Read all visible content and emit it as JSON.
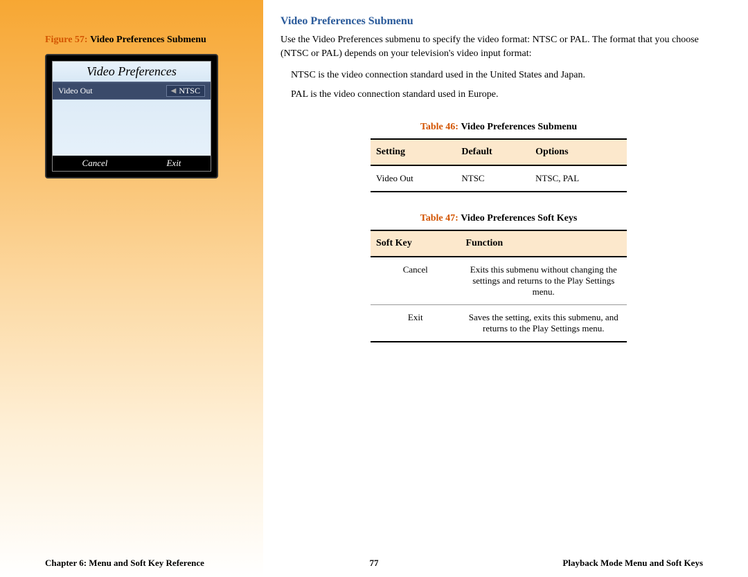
{
  "figure": {
    "label": "Figure 57:",
    "text": "Video Preferences Submenu"
  },
  "screenshot": {
    "title": "Video Preferences",
    "row_label": "Video Out",
    "row_value": "NTSC",
    "softkey_left": "Cancel",
    "softkey_right": "Exit"
  },
  "heading": "Video Preferences Submenu",
  "para1": "Use the Video Preferences submenu to specify the video format: NTSC or PAL. The format that you choose (NTSC or PAL) depends on your television's video input format:",
  "para2": "NTSC is the video connection standard used in the United States and Japan.",
  "para3": "PAL is the video connection standard used in Europe.",
  "table46": {
    "label": "Table 46:",
    "text": "Video Preferences Submenu",
    "headers": [
      "Setting",
      "Default",
      "Options"
    ],
    "rows": [
      [
        "Video Out",
        "NTSC",
        "NTSC, PAL"
      ]
    ]
  },
  "table47": {
    "label": "Table 47:",
    "text": "Video Preferences Soft Keys",
    "headers": [
      "Soft Key",
      "Function"
    ],
    "rows": [
      [
        "Cancel",
        "Exits this submenu without changing the settings and returns to the Play Settings menu."
      ],
      [
        "Exit",
        "Saves the setting, exits this submenu, and returns to the Play Settings menu."
      ]
    ]
  },
  "footer": {
    "left": "Chapter 6: Menu and Soft Key Reference",
    "center": "77",
    "right": "Playback Mode Menu and Soft Keys"
  }
}
